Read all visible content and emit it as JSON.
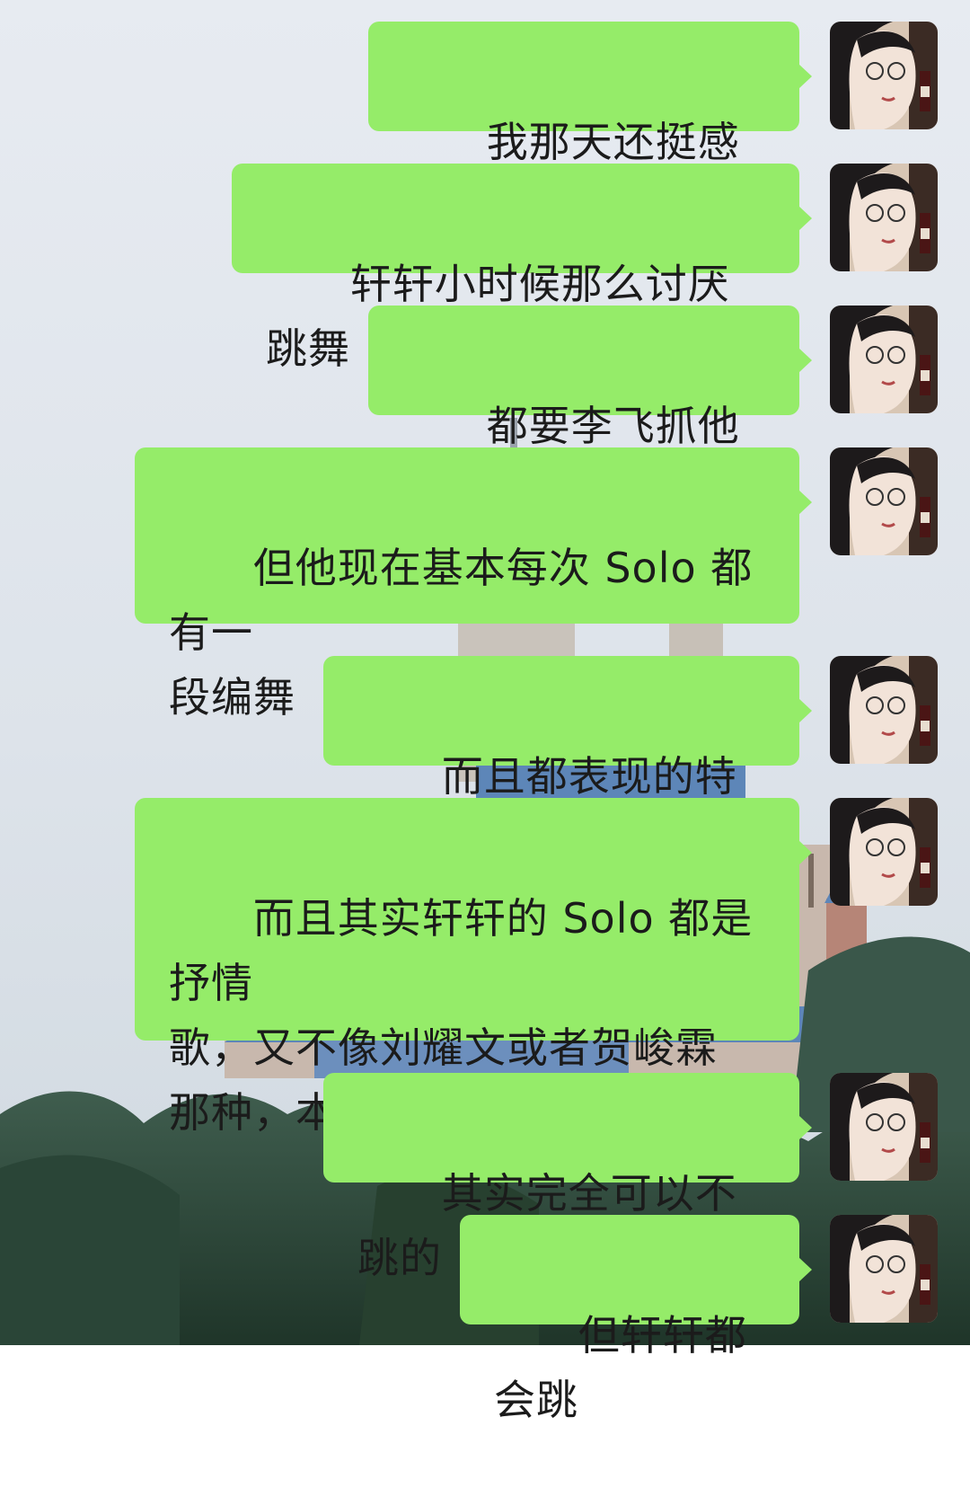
{
  "messages": [
    {
      "text": "我那天还挺感慨的"
    },
    {
      "text": "轩轩小时候那么讨厌跳舞"
    },
    {
      "text": "都要李飞抓他跳舞"
    },
    {
      "text": "但他现在基本每次 Solo 都有一\n段编舞"
    },
    {
      "text": "而且都表现的特别好"
    },
    {
      "text": "而且其实轩轩的 Solo 都是抒情\n歌，又不像刘耀文或者贺峻霖\n那种，本身就是比较炸的"
    },
    {
      "text": "其实完全可以不跳的"
    },
    {
      "text": "但轩轩都会跳"
    }
  ],
  "colors": {
    "bubble": "#95ec69",
    "text": "#1b1b1b",
    "sky": "#dfe5ec",
    "trees": "#2e4a3c",
    "castle_roof": "#5d86b8"
  },
  "icons": {
    "avatar": "user-avatar-icon"
  }
}
